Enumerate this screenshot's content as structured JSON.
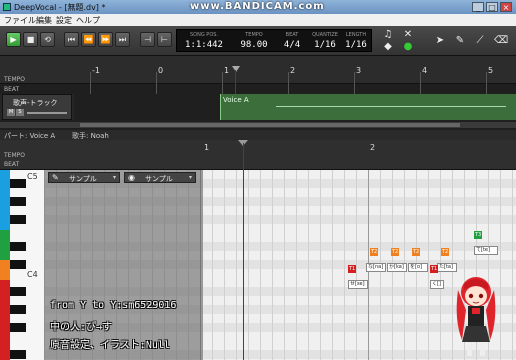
{
  "window": {
    "title": "DeepVocal - [無題.dv] *",
    "watermark": "www.BANDICAM.com"
  },
  "menu": [
    "ファイル",
    "編集",
    "設定",
    "ヘルプ"
  ],
  "transport": {
    "song_pos_label": "SONG POS.",
    "song_pos": "1:1:442",
    "tempo_label": "TEMPO",
    "tempo": "98.00",
    "beat_label": "BEAT",
    "beat": "4/4",
    "quantize_label": "QUANTIZE",
    "quantize": "1/16",
    "length_label": "LENGTH",
    "length": "1/16"
  },
  "timeline": {
    "tempo_label": "TEMPO",
    "beat_label": "BEAT",
    "measures": [
      "-1",
      "0",
      "1",
      "2",
      "3",
      "4",
      "5"
    ],
    "track_name": "歌声-トラック",
    "mute": "M",
    "solo": "S",
    "part_name": "Voice A"
  },
  "part_header": {
    "part": "パート: Voice A",
    "singer": "歌手: Noah"
  },
  "piano_roll": {
    "tempo_label": "TEMPO",
    "beat_label": "BEAT",
    "measures": [
      "1",
      "2"
    ],
    "key_c5": "C5",
    "key_c4": "C4",
    "combo_left": "サンプル",
    "combo_right": "サンプル"
  },
  "notes": [
    {
      "tag": "T1",
      "lyric": "せ[se]"
    },
    {
      "tag": "T2",
      "lyric": "な[na]"
    },
    {
      "tag": "T2",
      "lyric": "か[ka]"
    },
    {
      "tag": "T2",
      "lyric": "を[o]"
    },
    {
      "tag": "T2",
      "lyric": "た[ta]"
    },
    {
      "tag": "T1",
      "lyric": "く[]"
    },
    {
      "tag": "T3",
      "lyric": "て[te]"
    }
  ],
  "overlay": {
    "line1": "from Y to Y:sm6529016",
    "line2": "中の人:ぴ→す",
    "line3": "原音設定、イラスト:Null"
  },
  "colors": {
    "part_green": "#3b6e3b",
    "tag_red": "#d42020",
    "tag_orange": "#f08020",
    "tag_green": "#20a040",
    "play_green": "#33aa33"
  }
}
